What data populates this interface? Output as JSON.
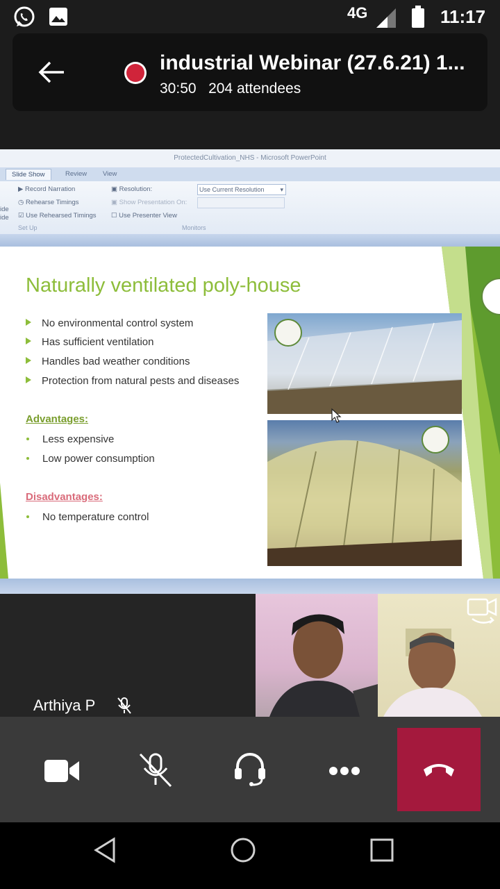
{
  "status_bar": {
    "network": "4G",
    "time": "11:17"
  },
  "call": {
    "title": "industrial Webinar (27.6.21) 1...",
    "duration": "30:50",
    "attendees": "204 attendees"
  },
  "ppt": {
    "window_title": "ProtectedCultivation_NHS - Microsoft PowerPoint",
    "tabs": [
      "Slide Show",
      "Review",
      "View"
    ],
    "ribbon": {
      "record_narration": "Record Narration",
      "rehearse_timings": "Rehearse Timings",
      "use_rehearsed_timings": "Use Rehearsed Timings",
      "group_setup": "Set Up",
      "resolution_label": "Resolution:",
      "resolution_value": "Use Current Resolution",
      "show_on_label": "Show Presentation On:",
      "presenter_view": "Use Presenter View",
      "group_monitors": "Monitors",
      "cut_top": "ide",
      "cut_bottom": "ide"
    },
    "slide": {
      "heading": "Naturally ventilated poly-house",
      "bullets": [
        "No environmental control system",
        "Has sufficient ventilation",
        "Handles bad weather conditions",
        "Protection from natural pests and diseases"
      ],
      "advantages_label": "Advantages:",
      "advantages": [
        "Less expensive",
        "Low power consumption"
      ],
      "disadvantages_label": "Disadvantages:",
      "disadvantages": [
        "No temperature control"
      ]
    }
  },
  "participants": {
    "presenter_name": "Arthiya P"
  },
  "colors": {
    "accent_green": "#8dbd3a",
    "hangup": "#a4193d",
    "record": "#d0243a",
    "disadv": "#d96b7a"
  }
}
